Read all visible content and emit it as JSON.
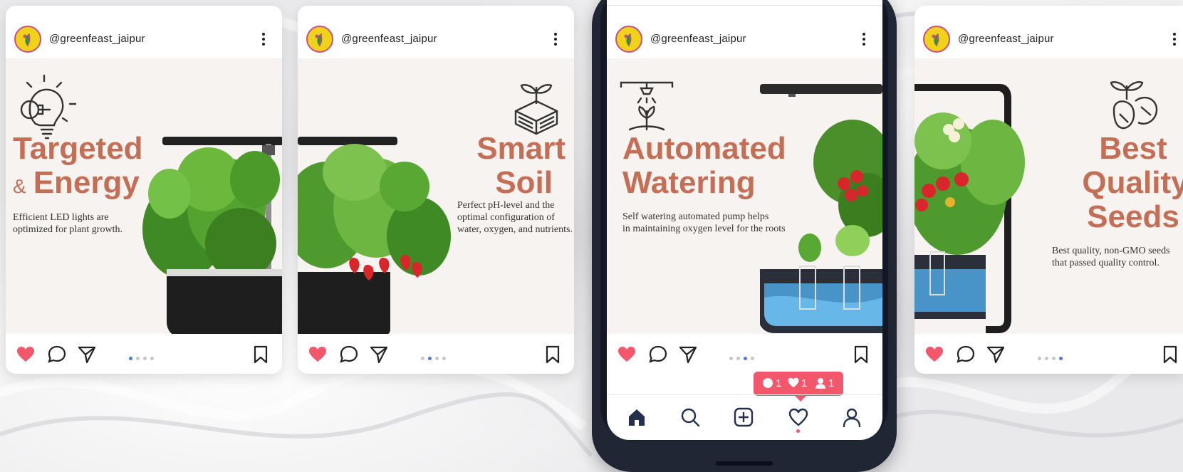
{
  "colors": {
    "accent_text": "#c46e55",
    "like": "#f2576c",
    "active_dot": "#4c7bd9",
    "phone_frame": "#202634"
  },
  "posts": [
    {
      "username": "@greenfeast_jaipur",
      "icon": "lightbulb-icon",
      "headline_line1": "Targeted",
      "headline_amp": "&",
      "headline_line2": "Energy",
      "description_line1": "Efficient LED lights are",
      "description_line2": "optimized for plant growth.",
      "slide_index": 1,
      "slide_count": 4
    },
    {
      "username": "@greenfeast_jaipur",
      "icon": "soil-sprout-icon",
      "headline_line1": "Smart",
      "headline_line2": "Soil",
      "description_line1": "Perfect pH-level and the",
      "description_line2": "optimal configuration of",
      "description_line3": "water, oxygen, and nutrients.",
      "slide_index": 2,
      "slide_count": 4
    },
    {
      "username": "@greenfeast_jaipur",
      "icon": "watering-sprinkler-icon",
      "headline_line1": "Automated",
      "headline_line2": "Watering",
      "description_line1": "Self watering automated pump helps",
      "description_line2": "in maintaining oxygen level for the roots",
      "slide_index": 3,
      "slide_count": 4
    },
    {
      "username": "@greenfeast_jaipur",
      "icon": "seed-sprout-icon",
      "headline_line1": "Best",
      "headline_line2": "Quality",
      "headline_line3": "Seeds",
      "description_line1": "Best quality, non-GMO seeds",
      "description_line2": "that passed quality control.",
      "slide_index": 4,
      "slide_count": 4
    }
  ],
  "notifications": {
    "comments": "1",
    "likes": "1",
    "followers": "1"
  },
  "tabbar": {
    "items": [
      "home-icon",
      "search-icon",
      "add-post-icon",
      "activity-heart-icon",
      "profile-icon"
    ],
    "active": "home-icon"
  }
}
